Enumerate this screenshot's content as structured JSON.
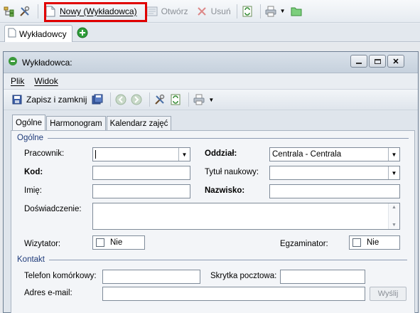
{
  "toolbar": {
    "new_label": "Nowy (Wykładowca)",
    "open_label": "Otwórz",
    "delete_label": "Usuń"
  },
  "tabs": {
    "main_tab": "Wykładowcy"
  },
  "window": {
    "title": "Wykładowca:",
    "menu": {
      "file": "Plik",
      "view": "Widok"
    },
    "toolbar": {
      "save_close_label": "Zapisz i zamknij"
    },
    "subtabs": [
      "Ogólne",
      "Harmonogram",
      "Kalendarz zajęć"
    ],
    "general": {
      "section_title": "Ogólne",
      "employee_label": "Pracownik:",
      "employee_value": "",
      "branch_label": "Oddział:",
      "branch_value": "Centrala - Centrala",
      "code_label": "Kod:",
      "code_value": "",
      "title_label": "Tytuł naukowy:",
      "title_value": "",
      "first_name_label": "Imię:",
      "first_name_value": "",
      "last_name_label": "Nazwisko:",
      "last_name_value": "",
      "experience_label": "Doświadczenie:",
      "experience_value": "",
      "visitor_label": "Wizytator:",
      "visitor_value": "Nie",
      "examiner_label": "Egzaminator:",
      "examiner_value": "Nie"
    },
    "contact": {
      "section_title": "Kontakt",
      "mobile_label": "Telefon komórkowy:",
      "mobile_value": "",
      "pobox_label": "Skrytka pocztowa:",
      "pobox_value": "",
      "email_label": "Adres e-mail:",
      "email_value": "",
      "send_label": "Wyślij"
    }
  }
}
